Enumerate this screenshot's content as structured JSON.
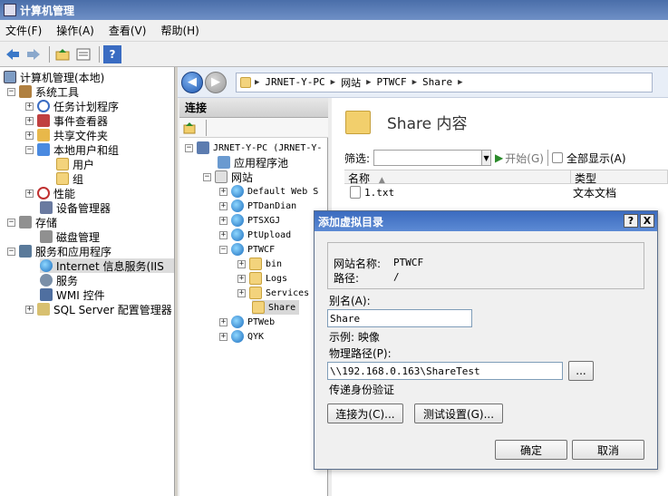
{
  "window": {
    "title": "计算机管理"
  },
  "menu": [
    "文件(F)",
    "操作(A)",
    "查看(V)",
    "帮助(H)"
  ],
  "toolbar": {
    "icons": [
      "back-arrow-icon",
      "forward-arrow-icon",
      "up-folder-icon",
      "properties-icon",
      "help-icon"
    ],
    "help_label": "?"
  },
  "left_tree": [
    {
      "label": "计算机管理(本地)",
      "icon": "computer-icon"
    },
    {
      "label": "系统工具",
      "icon": "tools-icon"
    },
    {
      "label": "任务计划程序",
      "icon": "clock-icon"
    },
    {
      "label": "事件查看器",
      "icon": "event-viewer-icon"
    },
    {
      "label": "共享文件夹",
      "icon": "shared-folder-icon"
    },
    {
      "label": "本地用户和组",
      "icon": "users-icon"
    },
    {
      "label": "用户",
      "icon": "folder-icon"
    },
    {
      "label": "组",
      "icon": "folder-icon"
    },
    {
      "label": "性能",
      "icon": "performance-icon"
    },
    {
      "label": "设备管理器",
      "icon": "device-manager-icon"
    },
    {
      "label": "存储",
      "icon": "storage-icon"
    },
    {
      "label": "磁盘管理",
      "icon": "disk-icon"
    },
    {
      "label": "服务和应用程序",
      "icon": "services-apps-icon"
    },
    {
      "label": "Internet 信息服务(IIS",
      "icon": "iis-globe-icon"
    },
    {
      "label": "服务",
      "icon": "gear-icon"
    },
    {
      "label": "WMI 控件",
      "icon": "wmi-icon"
    },
    {
      "label": "SQL Server 配置管理器",
      "icon": "sql-icon"
    }
  ],
  "address": {
    "crumbs": [
      "JRNET-Y-PC",
      "网站",
      "PTWCF",
      "Share"
    ]
  },
  "connections": {
    "title": "连接",
    "tree": [
      {
        "label": "JRNET-Y-PC (JRNET-Y-"
      },
      {
        "label": "应用程序池"
      },
      {
        "label": "网站"
      },
      {
        "label": "Default Web S"
      },
      {
        "label": "PTDanDian"
      },
      {
        "label": "PTSXGJ"
      },
      {
        "label": "PtUpload"
      },
      {
        "label": "PTWCF"
      },
      {
        "label": "bin"
      },
      {
        "label": "Logs"
      },
      {
        "label": "Services"
      },
      {
        "label": "Share"
      },
      {
        "label": "PTWeb"
      },
      {
        "label": "QYK"
      }
    ]
  },
  "content": {
    "title": "Share 内容",
    "filter_label": "筛选:",
    "start_label": "开始(G)",
    "show_all_label": "全部显示(A)",
    "col_name": "名称",
    "col_type": "类型",
    "file_name": "1.txt",
    "file_type": "文本文档"
  },
  "dialog": {
    "title": "添加虚拟目录",
    "help_btn": "?",
    "close_btn": "X",
    "site_name_label": "网站名称:",
    "site_name_value": "PTWCF",
    "path_label": "路径:",
    "path_value": "/",
    "alias_label": "别名(A):",
    "alias_value": "Share",
    "example_text": "示例: 映像",
    "physical_path_label": "物理路径(P):",
    "physical_path_value": "\\\\192.168.0.163\\ShareTest",
    "browse_btn": "...",
    "auth_text": "传递身份验证",
    "connect_as_btn": "连接为(C)...",
    "test_settings_btn": "测试设置(G)...",
    "ok_btn": "确定",
    "cancel_btn": "取消"
  }
}
